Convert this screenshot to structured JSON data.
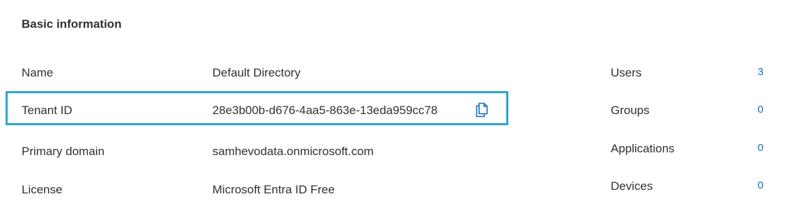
{
  "section": {
    "title": "Basic information"
  },
  "properties": [
    {
      "label": "Name",
      "value": "Default Directory"
    },
    {
      "label": "Tenant ID",
      "value": "28e3b00b-d676-4aa5-863e-13eda959cc78"
    },
    {
      "label": "Primary domain",
      "value": "samhevodata.onmicrosoft.com"
    },
    {
      "label": "License",
      "value": "Microsoft Entra ID Free"
    }
  ],
  "stats": [
    {
      "label": "Users",
      "value": "3"
    },
    {
      "label": "Groups",
      "value": "0"
    },
    {
      "label": "Applications",
      "value": "0"
    },
    {
      "label": "Devices",
      "value": "0"
    }
  ],
  "colors": {
    "highlight_border": "#2aa8c8",
    "link": "#0f6cbd",
    "text": "#323130"
  },
  "icons": {
    "copy": "copy-icon"
  }
}
